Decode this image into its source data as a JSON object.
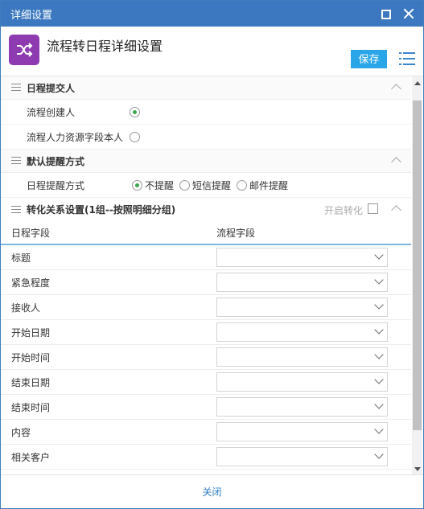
{
  "window": {
    "title": "详细设置"
  },
  "header": {
    "title": "流程转日程详细设置",
    "save_label": "保存"
  },
  "section_submitter": {
    "title": "日程提交人",
    "options": [
      {
        "label": "流程创建人",
        "selected": true
      },
      {
        "label": "流程人力资源字段本人",
        "selected": false
      }
    ]
  },
  "section_reminder": {
    "title": "默认提醒方式",
    "field_label": "日程提醒方式",
    "options": [
      {
        "label": "不提醒",
        "selected": true
      },
      {
        "label": "短信提醒",
        "selected": false
      },
      {
        "label": "邮件提醒",
        "selected": false
      }
    ]
  },
  "section_mapping": {
    "title": "转化关系设置(1组--按照明细分组)",
    "toggle_label": "开启转化",
    "col_schedule": "日程字段",
    "col_flow": "流程字段",
    "rows": [
      "标题",
      "紧急程度",
      "接收人",
      "开始日期",
      "开始时间",
      "结束日期",
      "结束时间",
      "内容",
      "相关客户"
    ]
  },
  "footer": {
    "close_label": "关闭"
  },
  "colors": {
    "titlebar": "#3b78bf",
    "save": "#29a5e8",
    "app_icon": "#8e3ab1",
    "radio_on": "#3ca84a"
  },
  "icons": {
    "app": "shuffle-icon",
    "menu": "list-icon",
    "maximize": "maximize-icon",
    "close": "close-icon"
  }
}
